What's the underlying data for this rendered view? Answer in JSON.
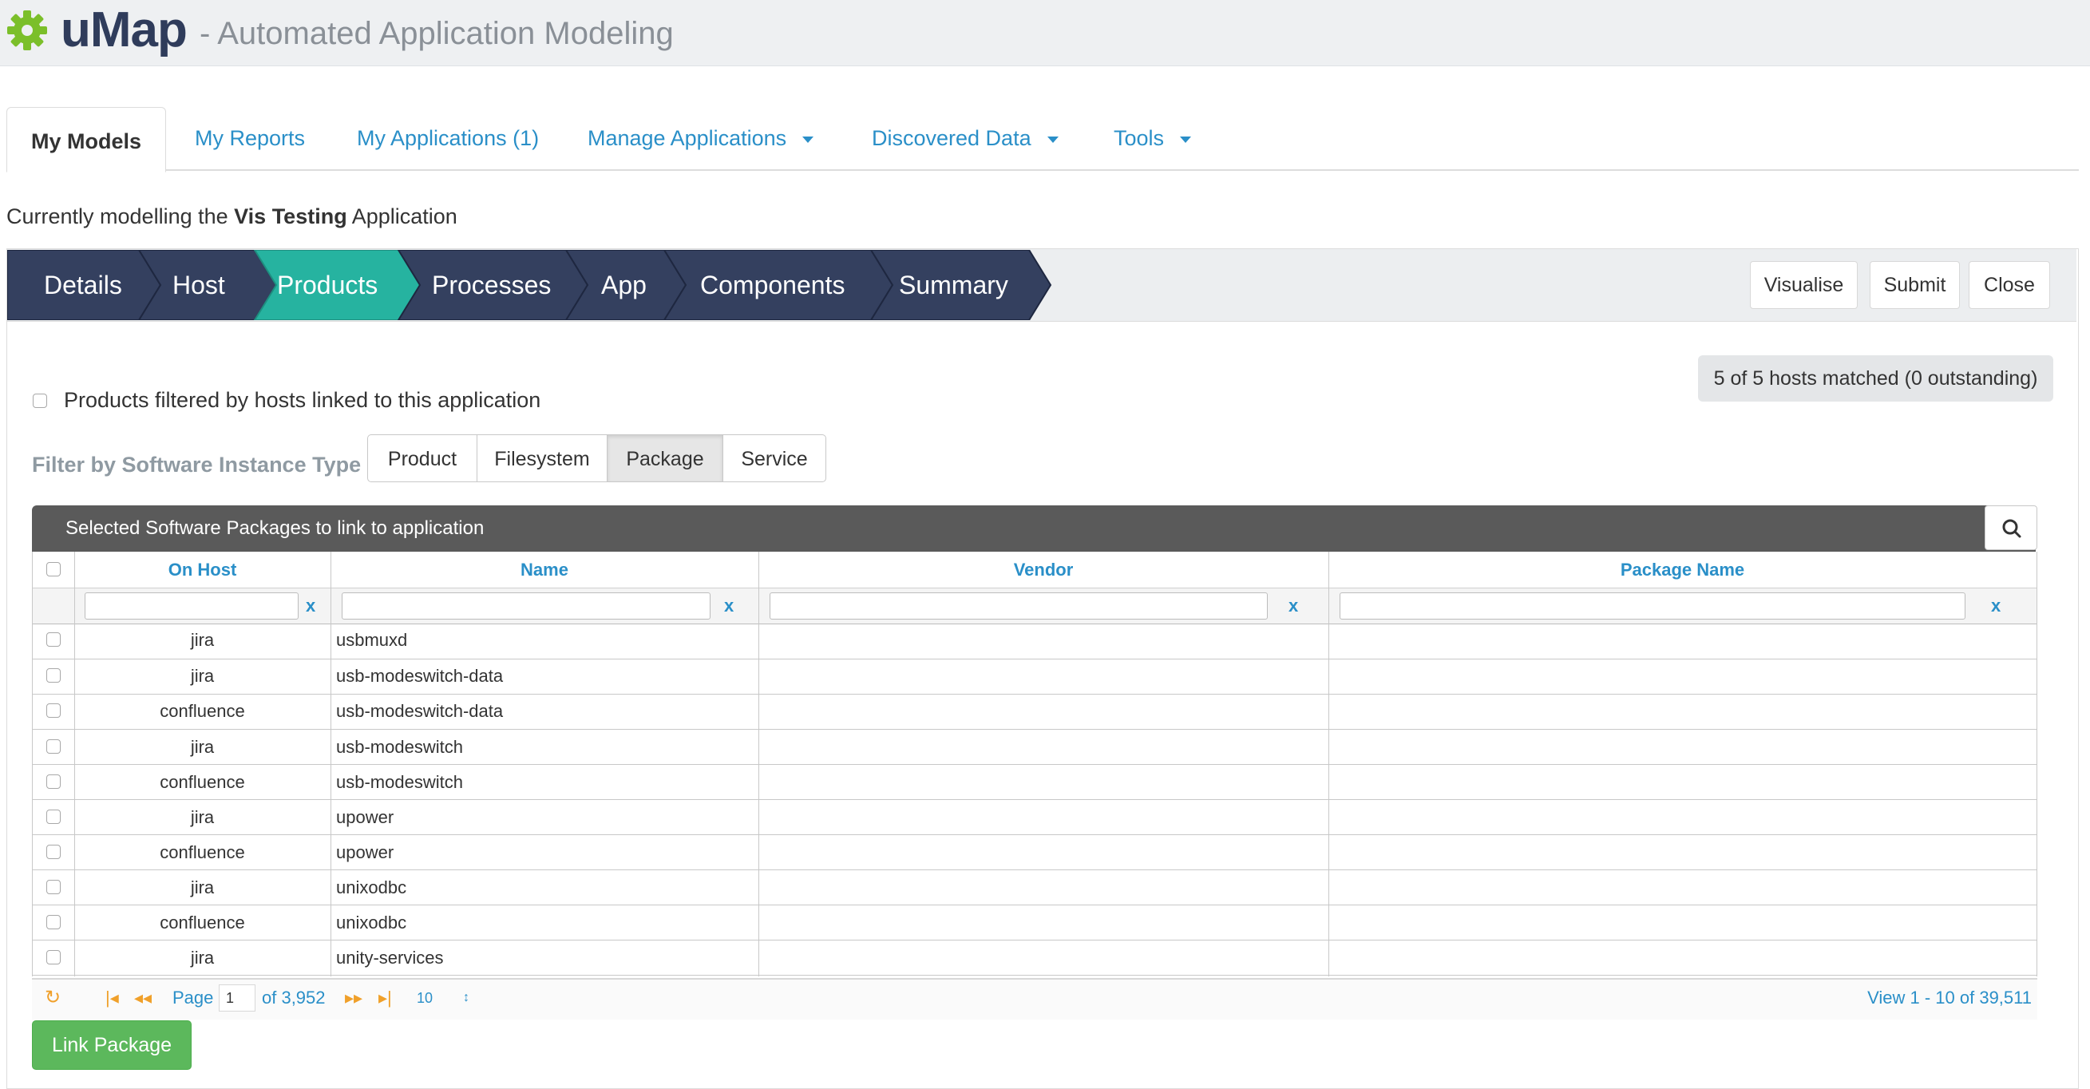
{
  "app": {
    "brand": "uMap",
    "subtitle": "- Automated Application Modeling"
  },
  "tabs": [
    {
      "label": "My Models",
      "active": true
    },
    {
      "label": "My Reports"
    },
    {
      "label": "My Applications (1)"
    },
    {
      "label": "Manage Applications",
      "dropdown": true
    },
    {
      "label": "Discovered Data",
      "dropdown": true
    },
    {
      "label": "Tools",
      "dropdown": true
    }
  ],
  "modelling": {
    "prefix": "Currently modelling the",
    "app_name": "Vis Testing",
    "suffix": "Application"
  },
  "wizard": {
    "steps": [
      "Details",
      "Host",
      "Products",
      "Processes",
      "App",
      "Components",
      "Summary"
    ],
    "active_step": "Products",
    "actions": {
      "visualise": "Visualise",
      "submit": "Submit",
      "close": "Close"
    }
  },
  "hosts_matched": "5 of 5 hosts matched (0 outstanding)",
  "filter": {
    "checkbox_label": "Products filtered by hosts linked to this application",
    "type_label": "Filter by Software Instance Type",
    "types": [
      "Product",
      "Filesystem",
      "Package",
      "Service"
    ],
    "selected_type": "Package"
  },
  "grid": {
    "title": "Selected Software Packages to link to application",
    "columns": [
      "On Host",
      "Name",
      "Vendor",
      "Package Name"
    ],
    "clear_label": "x",
    "rows": [
      {
        "host": "jira",
        "name": "usbmuxd",
        "vendor": "",
        "package": ""
      },
      {
        "host": "jira",
        "name": "usb-modeswitch-data",
        "vendor": "",
        "package": ""
      },
      {
        "host": "confluence",
        "name": "usb-modeswitch-data",
        "vendor": "",
        "package": ""
      },
      {
        "host": "jira",
        "name": "usb-modeswitch",
        "vendor": "",
        "package": ""
      },
      {
        "host": "confluence",
        "name": "usb-modeswitch",
        "vendor": "",
        "package": ""
      },
      {
        "host": "jira",
        "name": "upower",
        "vendor": "",
        "package": ""
      },
      {
        "host": "confluence",
        "name": "upower",
        "vendor": "",
        "package": ""
      },
      {
        "host": "jira",
        "name": "unixodbc",
        "vendor": "",
        "package": ""
      },
      {
        "host": "confluence",
        "name": "unixodbc",
        "vendor": "",
        "package": ""
      },
      {
        "host": "jira",
        "name": "unity-services",
        "vendor": "",
        "package": ""
      }
    ]
  },
  "pager": {
    "page_label": "Page",
    "page_value": "1",
    "of_pages": "of 3,952",
    "page_size": "10",
    "view_info": "View 1 - 10 of 39,511"
  },
  "link_button": "Link Package",
  "colors": {
    "navy": "#2f3c5b",
    "teal": "#26b3a0",
    "link": "#2a8fc8",
    "green": "#5cb85c",
    "gear": "#7bbf2a"
  }
}
